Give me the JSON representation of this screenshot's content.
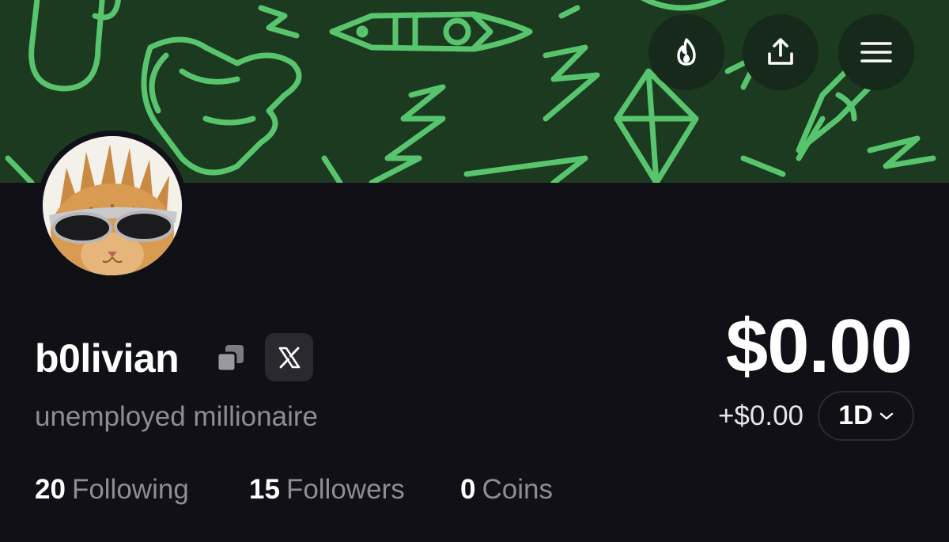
{
  "header": {
    "icons": [
      "flame-icon",
      "share-upload-icon",
      "hamburger-menu-icon"
    ]
  },
  "profile": {
    "username": "b0livian",
    "bio": "unemployed millionaire",
    "avatar": "cat-with-sunglasses"
  },
  "stats": {
    "following_count": "20",
    "following_label": "Following",
    "followers_count": "15",
    "followers_label": "Followers",
    "coins_count": "0",
    "coins_label": "Coins"
  },
  "portfolio": {
    "balance": "$0.00",
    "change": "+$0.00",
    "period": "1D"
  },
  "colors": {
    "banner_bg": "#1b3a1f",
    "pattern": "#58c46e",
    "page_bg": "#111016",
    "muted_text": "#8e8d95"
  }
}
